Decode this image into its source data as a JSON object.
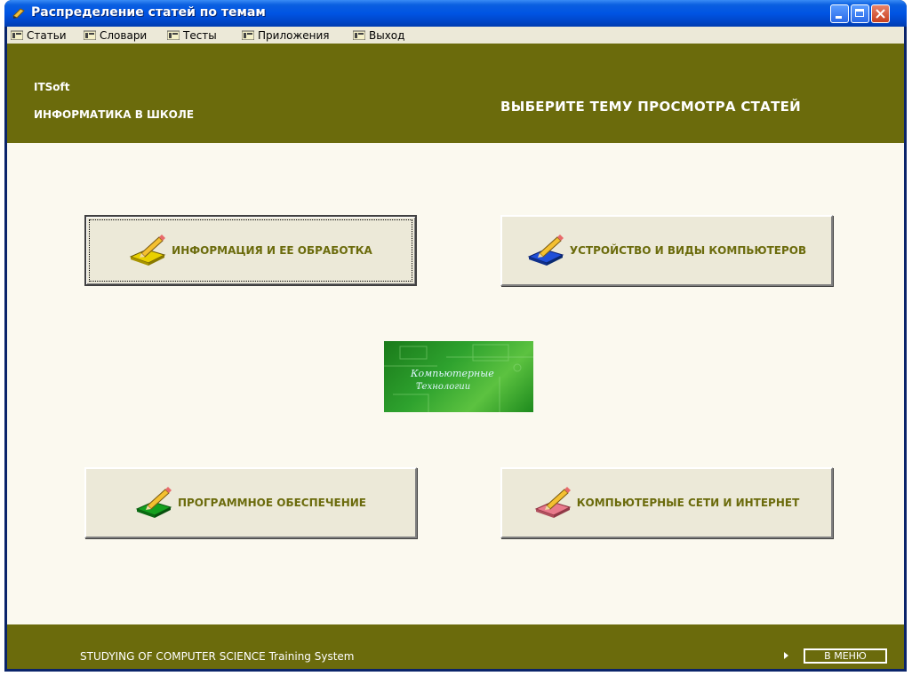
{
  "window": {
    "title": "Распределение статей по темам"
  },
  "menubar": {
    "items": [
      "Статьи",
      "Словари",
      "Тесты",
      "Приложения",
      "Выход"
    ]
  },
  "header": {
    "brand": "ITSoft",
    "subtitle": "ИНФОРМАТИКА В ШКОЛЕ",
    "prompt": "ВЫБЕРИТЕ ТЕМУ ПРОСМОТРА СТАТЕЙ"
  },
  "topics": [
    {
      "label": "ИНФОРМАЦИЯ И ЕЕ ОБРАБОТКА",
      "icon": "pencil-yellow-icon",
      "color": "#e8d000"
    },
    {
      "label": "УСТРОЙСТВО И ВИДЫ КОМПЬЮТЕРОВ",
      "icon": "pencil-blue-icon",
      "color": "#1f4fd8"
    },
    {
      "label": "ПРОГРАММНОЕ ОБЕСПЕЧЕНИЕ",
      "icon": "pencil-green-icon",
      "color": "#14a01e"
    },
    {
      "label": "КОМПЬЮТЕРНЫЕ СЕТИ И ИНТЕРНЕТ",
      "icon": "pencil-pink-icon",
      "color": "#e87a8c"
    }
  ],
  "logo": {
    "line1": "Компьютерные",
    "line2": "Технологии"
  },
  "footer": {
    "text": "STUDYING OF COMPUTER SCIENCE Training System",
    "menu_button": "В МЕНЮ"
  },
  "colors": {
    "accent": "#6b6b0c",
    "background": "#fbf9ef",
    "button_face": "#ece9d8"
  }
}
